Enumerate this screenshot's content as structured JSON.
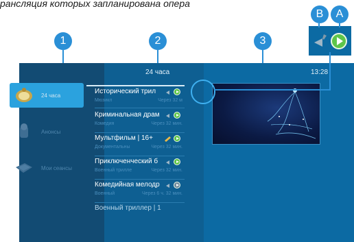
{
  "caption": "рансляция которых запланирована опера",
  "markers": {
    "m1": "1",
    "m2": "2",
    "m3": "3",
    "mB": "B",
    "mA": "A"
  },
  "header": {
    "title": "24 часа",
    "time": "13:28"
  },
  "sidebar": {
    "items": [
      {
        "label": "24 часа"
      },
      {
        "label": "Анонсы"
      },
      {
        "label": "Мои сеансы"
      }
    ]
  },
  "list": {
    "rows": [
      {
        "title": "Исторический трил",
        "genre": "Мюзикл",
        "when": "Через 32 м"
      },
      {
        "title": "Криминальная драм",
        "genre": "Комедия",
        "when": "Через 32 мин."
      },
      {
        "title": "Мультфильм | 16+",
        "genre": "Документальны",
        "when": "Через 32 мин."
      },
      {
        "title": "Приключенческий б",
        "genre": "Военный трилле",
        "when": "Через 32 мин."
      },
      {
        "title": "Комедийная мелодр",
        "genre": "Военный",
        "when": "Через 6 ч. 32 мин."
      },
      {
        "title": "Военный триллер | 1",
        "genre": "",
        "when": ""
      }
    ]
  },
  "colors": {
    "accent": "#2a8fd6",
    "play": "#5ec54a",
    "screen_bg": "#0c6aa3",
    "sidebar_bg": "#124b73"
  },
  "icons": [
    "watch-icon",
    "alarm-icon",
    "ticket-icon",
    "remind-icon",
    "play-icon"
  ]
}
